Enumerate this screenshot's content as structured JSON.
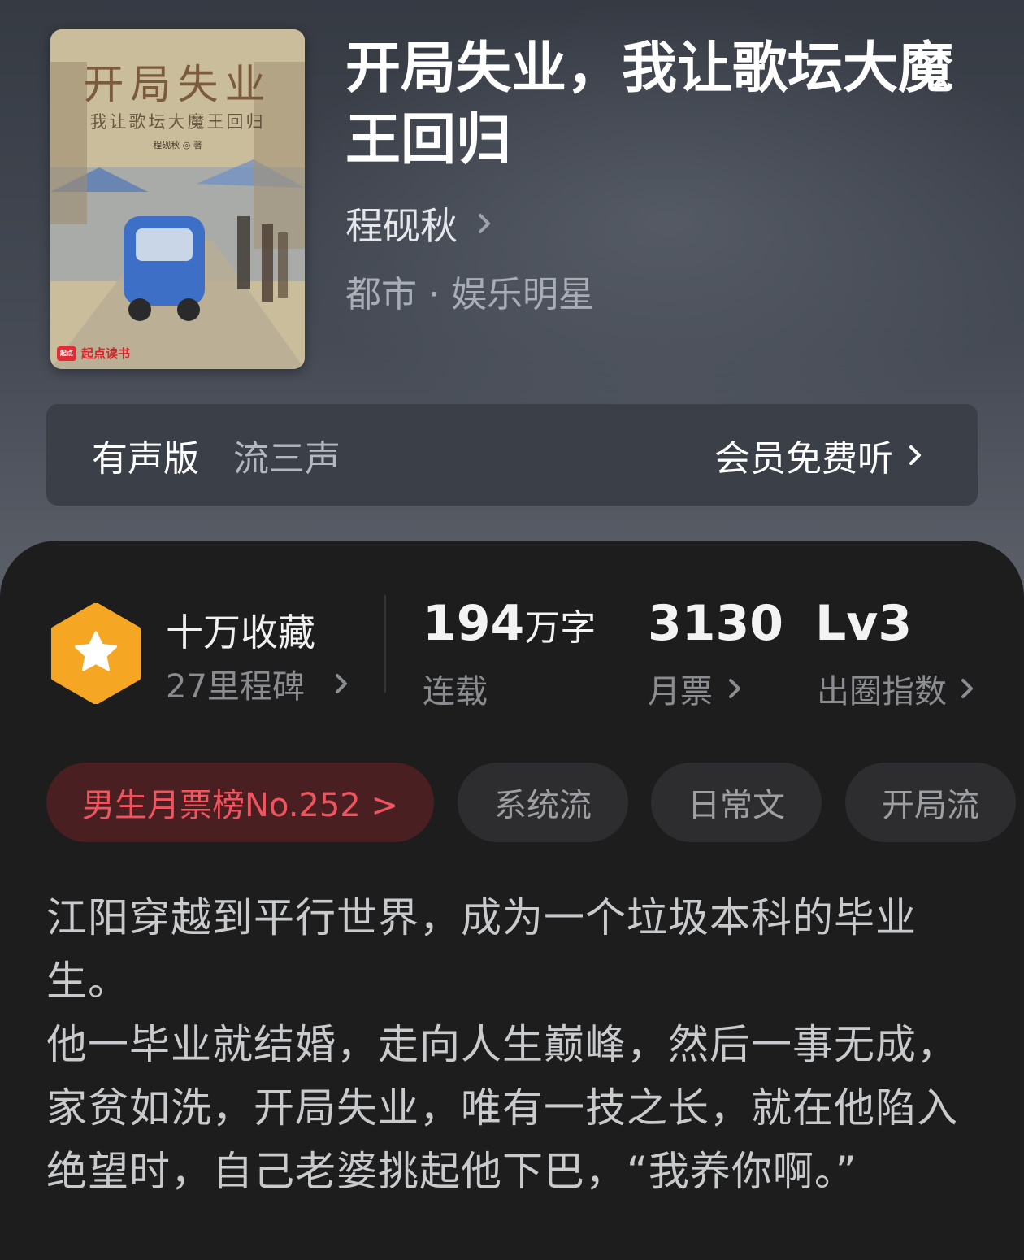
{
  "book": {
    "cover": {
      "title": "开局失业",
      "subtitle": "我让歌坛大魔王回归",
      "author_line": "程砚秋 ◎ 著",
      "publisher_logo": "起点读书",
      "publisher_mark": "起点"
    },
    "title": "开局失业，我让歌坛大魔王回归",
    "author": "程砚秋",
    "category": "都市 · 娱乐明星"
  },
  "audio": {
    "label": "有声版",
    "narrator": "流三声",
    "cta": "会员免费听"
  },
  "stats": {
    "collect_title": "十万收藏",
    "milestone": "27里程碑",
    "words_value": "194",
    "words_unit": "万字",
    "words_status": "连载",
    "monthly_votes": "3130",
    "monthly_votes_label": "月票",
    "level": "Lv3",
    "level_label": "出圈指数"
  },
  "tags": [
    "男生月票榜No.252 >",
    "系统流",
    "日常文",
    "开局流"
  ],
  "description": [
    "江阳穿越到平行世界，成为一个垃圾本科的毕业生。",
    "他一毕业就结婚，走向人生巅峰，然后一事无成，家贫如洗，开局失业，唯有一技之长，就在他陷入绝望时，自己老婆挑起他下巴，“我养你啊。”"
  ],
  "colors": {
    "panel_bg": "#1d1d1e",
    "rank_tag_text": "#f0555f",
    "rank_tag_bg": "#4a1f22",
    "medal": "#f5a623"
  },
  "icons": [
    "chevron-right-icon",
    "star-medal-icon"
  ]
}
